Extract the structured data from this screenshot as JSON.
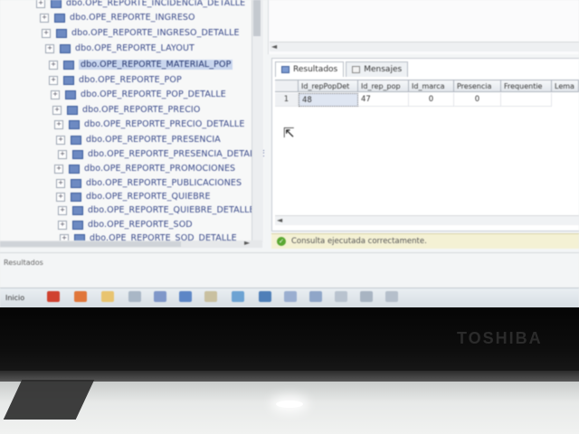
{
  "tree": {
    "items": [
      {
        "label": "dbo.OPE_REPORTE_INCIDENCIA_DETALLE",
        "selected": false
      },
      {
        "label": "dbo.OPE_REPORTE_INGRESO",
        "selected": false
      },
      {
        "label": "dbo.OPE_REPORTE_INGRESO_DETALLE",
        "selected": false
      },
      {
        "label": "dbo.OPE_REPORTE_LAYOUT",
        "selected": false
      },
      {
        "label": "dbo.OPE_REPORTE_MATERIAL_POP",
        "selected": true
      },
      {
        "label": "dbo.OPE_REPORTE_POP",
        "selected": false
      },
      {
        "label": "dbo.OPE_REPORTE_POP_DETALLE",
        "selected": false
      },
      {
        "label": "dbo.OPE_REPORTE_PRECIO",
        "selected": false
      },
      {
        "label": "dbo.OPE_REPORTE_PRECIO_DETALLE",
        "selected": false
      },
      {
        "label": "dbo.OPE_REPORTE_PRESENCIA",
        "selected": false
      },
      {
        "label": "dbo.OPE_REPORTE_PRESENCIA_DETALLE",
        "selected": false
      },
      {
        "label": "dbo.OPE_REPORTE_PROMOCIONES",
        "selected": false
      },
      {
        "label": "dbo.OPE_REPORTE_PUBLICACIONES",
        "selected": false
      },
      {
        "label": "dbo.OPE_REPORTE_QUIEBRE",
        "selected": false
      },
      {
        "label": "dbo.OPE_REPORTE_QUIEBRE_DETALLE",
        "selected": false
      },
      {
        "label": "dbo.OPE_REPORTE_SOD",
        "selected": false
      },
      {
        "label": "dbo.OPE_REPORTE_SOD_DETALLE",
        "selected": false
      }
    ]
  },
  "results": {
    "tabs": [
      {
        "label": "Resultados",
        "active": true
      },
      {
        "label": "Mensajes",
        "active": false
      }
    ],
    "columns": [
      "Id_repPopDet",
      "Id_rep_pop",
      "Id_marca",
      "Presencia",
      "Frequentie",
      "Lema"
    ],
    "rows": [
      {
        "rownum": "1",
        "cells": [
          "48",
          "47",
          "0",
          "0",
          ""
        ]
      }
    ]
  },
  "status": {
    "text": "Consulta ejecutada correctamente."
  },
  "output_label": "Resultados",
  "taskbar": {
    "start_label": "Inicio"
  },
  "brand": "TOSHIBA",
  "colors": {
    "tree_text": "#3a4a8a",
    "status_bg": "#f4f1d4",
    "status_ok": "#5aa832"
  }
}
